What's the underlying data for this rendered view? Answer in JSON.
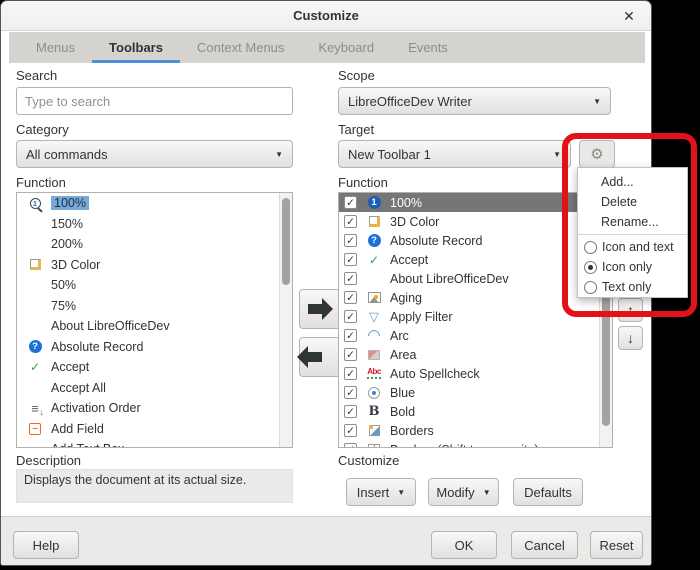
{
  "window": {
    "title": "Customize"
  },
  "icons": {
    "close": "✕",
    "gear": "⚙",
    "up": "↑",
    "down": "↓",
    "caret": "▼",
    "check": "✓"
  },
  "tabs": [
    {
      "label": "Menus",
      "active": false
    },
    {
      "label": "Toolbars",
      "active": true
    },
    {
      "label": "Context Menus",
      "active": false
    },
    {
      "label": "Keyboard",
      "active": false
    },
    {
      "label": "Events",
      "active": false
    }
  ],
  "left": {
    "search_label": "Search",
    "search_placeholder": "Type to search",
    "category_label": "Category",
    "category_value": "All commands",
    "function_label": "Function",
    "items": [
      {
        "icon": "zoom-100-icon",
        "label": "100%",
        "selected": true
      },
      {
        "icon": "",
        "label": "150%"
      },
      {
        "icon": "",
        "label": "200%"
      },
      {
        "icon": "3d-color-icon",
        "label": "3D Color"
      },
      {
        "icon": "",
        "label": "50%"
      },
      {
        "icon": "",
        "label": "75%"
      },
      {
        "icon": "",
        "label": "About LibreOfficeDev"
      },
      {
        "icon": "help-circle-icon",
        "label": "Absolute Record"
      },
      {
        "icon": "check-icon",
        "label": "Accept"
      },
      {
        "icon": "",
        "label": "Accept All"
      },
      {
        "icon": "activation-order-icon",
        "label": "Activation Order"
      },
      {
        "icon": "add-field-icon",
        "label": "Add Field"
      },
      {
        "icon": "",
        "label": "Add Text Box"
      }
    ]
  },
  "right": {
    "scope_label": "Scope",
    "scope_value": "LibreOfficeDev Writer",
    "target_label": "Target",
    "target_value": "New Toolbar 1",
    "function_label": "Function",
    "items": [
      {
        "icon": "info-1-icon",
        "label": "100%",
        "checked": true,
        "selected": true
      },
      {
        "icon": "3d-color-icon",
        "label": "3D Color",
        "checked": true
      },
      {
        "icon": "help-circle-icon",
        "label": "Absolute Record",
        "checked": true
      },
      {
        "icon": "check-icon",
        "label": "Accept",
        "checked": true
      },
      {
        "icon": "",
        "label": "About LibreOfficeDev",
        "checked": true
      },
      {
        "icon": "image-icon",
        "label": "Aging",
        "checked": true
      },
      {
        "icon": "funnel-icon",
        "label": "Apply Filter",
        "checked": true
      },
      {
        "icon": "arc-icon",
        "label": "Arc",
        "checked": true
      },
      {
        "icon": "area-icon",
        "label": "Area",
        "checked": true
      },
      {
        "icon": "spellcheck-icon",
        "label": "Auto Spellcheck",
        "checked": true
      },
      {
        "icon": "palette-icon",
        "label": "Blue",
        "checked": true
      },
      {
        "icon": "bold-icon",
        "label": "Bold",
        "checked": true
      },
      {
        "icon": "borders-icon",
        "label": "Borders",
        "checked": true
      },
      {
        "icon": "borders-shift-icon",
        "label": "Borders (Shift to overwrite)",
        "checked": true
      }
    ]
  },
  "popup": {
    "actions": [
      "Add...",
      "Delete",
      "Rename..."
    ],
    "radios": [
      {
        "label": "Icon and text",
        "selected": false
      },
      {
        "label": "Icon only",
        "selected": true
      },
      {
        "label": "Text only",
        "selected": false
      }
    ]
  },
  "description": {
    "label": "Description",
    "text": "Displays the document at its actual size."
  },
  "customize": {
    "label": "Customize",
    "insert_label": "Insert",
    "modify_label": "Modify",
    "defaults_label": "Defaults"
  },
  "footer": {
    "help": "Help",
    "ok": "OK",
    "cancel": "Cancel",
    "reset": "Reset"
  },
  "colors": {
    "accent": "#4a90d9",
    "annotation": "#e31219",
    "selection_left": "#7aa9d8",
    "selection_right": "#767676"
  }
}
